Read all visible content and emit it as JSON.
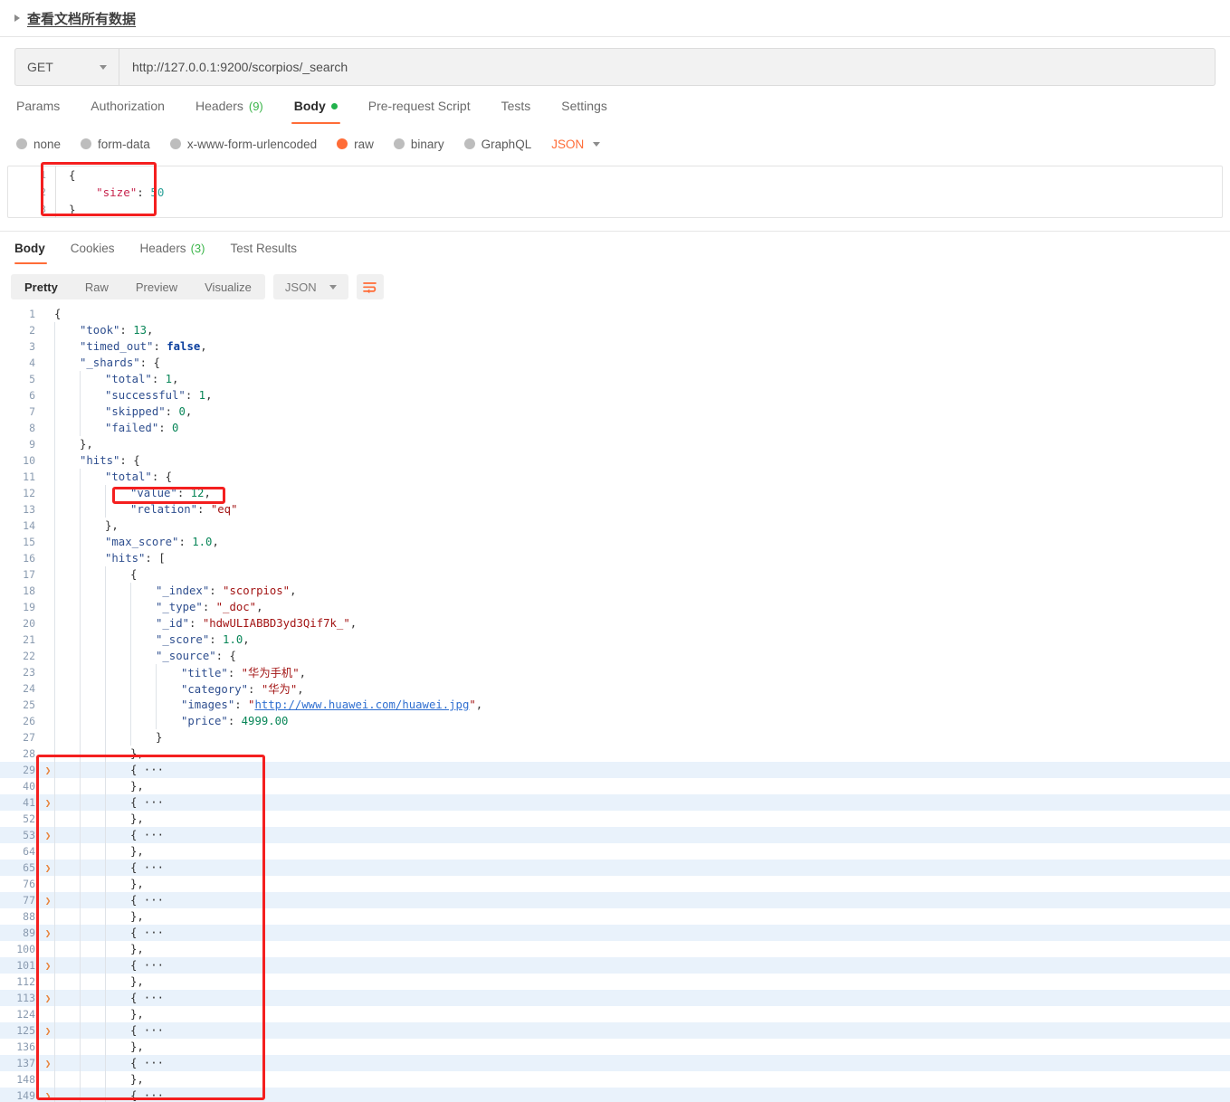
{
  "window": {
    "title": "查看文档所有数据",
    "collapse_icon": "triangle-right-icon"
  },
  "request": {
    "method": "GET",
    "url": "http://127.0.0.1:9200/scorpios/_search",
    "tabs": [
      {
        "label": "Params",
        "badge": "",
        "active": false
      },
      {
        "label": "Authorization",
        "badge": "",
        "active": false
      },
      {
        "label": "Headers",
        "badge": "(9)",
        "active": false
      },
      {
        "label": "Body",
        "badge": "",
        "active": true,
        "dot": true
      },
      {
        "label": "Pre-request Script",
        "badge": "",
        "active": false
      },
      {
        "label": "Tests",
        "badge": "",
        "active": false
      },
      {
        "label": "Settings",
        "badge": "",
        "active": false
      }
    ],
    "body_types": [
      {
        "label": "none",
        "selected": false
      },
      {
        "label": "form-data",
        "selected": false
      },
      {
        "label": "x-www-form-urlencoded",
        "selected": false
      },
      {
        "label": "raw",
        "selected": true
      },
      {
        "label": "binary",
        "selected": false
      },
      {
        "label": "GraphQL",
        "selected": false
      }
    ],
    "raw_format": "JSON",
    "editor_lines": [
      {
        "n": "1",
        "code": "{"
      },
      {
        "n": "2",
        "code": "    \"size\": 50"
      },
      {
        "n": "3",
        "code": "}"
      }
    ],
    "annotation": "red-highlight-box-request-size"
  },
  "response": {
    "tabs": [
      {
        "label": "Body",
        "badge": "",
        "active": true
      },
      {
        "label": "Cookies",
        "badge": "",
        "active": false
      },
      {
        "label": "Headers",
        "badge": "(3)",
        "active": false
      },
      {
        "label": "Test Results",
        "badge": "",
        "active": false
      }
    ],
    "view_modes": [
      {
        "label": "Pretty",
        "active": true
      },
      {
        "label": "Raw",
        "active": false
      },
      {
        "label": "Preview",
        "active": false
      },
      {
        "label": "Visualize",
        "active": false
      }
    ],
    "format": "JSON",
    "wrap_icon": "wrap-text-icon",
    "annotations": [
      "red-highlight-box-hits-total-value",
      "red-highlight-box-collapsed-hits"
    ],
    "json_lines": [
      {
        "n": "1",
        "indent": 0,
        "tokens": [
          {
            "t": "punc",
            "v": "{"
          }
        ]
      },
      {
        "n": "2",
        "indent": 1,
        "tokens": [
          {
            "t": "key",
            "v": "\"took\""
          },
          {
            "t": "punc",
            "v": ": "
          },
          {
            "t": "num",
            "v": "13"
          },
          {
            "t": "punc",
            "v": ","
          }
        ]
      },
      {
        "n": "3",
        "indent": 1,
        "tokens": [
          {
            "t": "key",
            "v": "\"timed_out\""
          },
          {
            "t": "punc",
            "v": ": "
          },
          {
            "t": "bool",
            "v": "false"
          },
          {
            "t": "punc",
            "v": ","
          }
        ]
      },
      {
        "n": "4",
        "indent": 1,
        "tokens": [
          {
            "t": "key",
            "v": "\"_shards\""
          },
          {
            "t": "punc",
            "v": ": {"
          }
        ]
      },
      {
        "n": "5",
        "indent": 2,
        "tokens": [
          {
            "t": "key",
            "v": "\"total\""
          },
          {
            "t": "punc",
            "v": ": "
          },
          {
            "t": "num",
            "v": "1"
          },
          {
            "t": "punc",
            "v": ","
          }
        ]
      },
      {
        "n": "6",
        "indent": 2,
        "tokens": [
          {
            "t": "key",
            "v": "\"successful\""
          },
          {
            "t": "punc",
            "v": ": "
          },
          {
            "t": "num",
            "v": "1"
          },
          {
            "t": "punc",
            "v": ","
          }
        ]
      },
      {
        "n": "7",
        "indent": 2,
        "tokens": [
          {
            "t": "key",
            "v": "\"skipped\""
          },
          {
            "t": "punc",
            "v": ": "
          },
          {
            "t": "num",
            "v": "0"
          },
          {
            "t": "punc",
            "v": ","
          }
        ]
      },
      {
        "n": "8",
        "indent": 2,
        "tokens": [
          {
            "t": "key",
            "v": "\"failed\""
          },
          {
            "t": "punc",
            "v": ": "
          },
          {
            "t": "num",
            "v": "0"
          }
        ]
      },
      {
        "n": "9",
        "indent": 1,
        "tokens": [
          {
            "t": "punc",
            "v": "},"
          }
        ]
      },
      {
        "n": "10",
        "indent": 1,
        "tokens": [
          {
            "t": "key",
            "v": "\"hits\""
          },
          {
            "t": "punc",
            "v": ": {"
          }
        ]
      },
      {
        "n": "11",
        "indent": 2,
        "tokens": [
          {
            "t": "key",
            "v": "\"total\""
          },
          {
            "t": "punc",
            "v": ": {"
          }
        ]
      },
      {
        "n": "12",
        "indent": 3,
        "tokens": [
          {
            "t": "key",
            "v": "\"value\""
          },
          {
            "t": "punc",
            "v": ": "
          },
          {
            "t": "num",
            "v": "12"
          },
          {
            "t": "punc",
            "v": ","
          }
        ]
      },
      {
        "n": "13",
        "indent": 3,
        "tokens": [
          {
            "t": "key",
            "v": "\"relation\""
          },
          {
            "t": "punc",
            "v": ": "
          },
          {
            "t": "str",
            "v": "\"eq\""
          }
        ]
      },
      {
        "n": "14",
        "indent": 2,
        "tokens": [
          {
            "t": "punc",
            "v": "},"
          }
        ]
      },
      {
        "n": "15",
        "indent": 2,
        "tokens": [
          {
            "t": "key",
            "v": "\"max_score\""
          },
          {
            "t": "punc",
            "v": ": "
          },
          {
            "t": "num",
            "v": "1.0"
          },
          {
            "t": "punc",
            "v": ","
          }
        ]
      },
      {
        "n": "16",
        "indent": 2,
        "tokens": [
          {
            "t": "key",
            "v": "\"hits\""
          },
          {
            "t": "punc",
            "v": ": ["
          }
        ]
      },
      {
        "n": "17",
        "indent": 3,
        "tokens": [
          {
            "t": "punc",
            "v": "{"
          }
        ]
      },
      {
        "n": "18",
        "indent": 4,
        "tokens": [
          {
            "t": "key",
            "v": "\"_index\""
          },
          {
            "t": "punc",
            "v": ": "
          },
          {
            "t": "str",
            "v": "\"scorpios\""
          },
          {
            "t": "punc",
            "v": ","
          }
        ]
      },
      {
        "n": "19",
        "indent": 4,
        "tokens": [
          {
            "t": "key",
            "v": "\"_type\""
          },
          {
            "t": "punc",
            "v": ": "
          },
          {
            "t": "str",
            "v": "\"_doc\""
          },
          {
            "t": "punc",
            "v": ","
          }
        ]
      },
      {
        "n": "20",
        "indent": 4,
        "tokens": [
          {
            "t": "key",
            "v": "\"_id\""
          },
          {
            "t": "punc",
            "v": ": "
          },
          {
            "t": "str",
            "v": "\"hdwULIABBD3yd3Qif7k_\""
          },
          {
            "t": "punc",
            "v": ","
          }
        ]
      },
      {
        "n": "21",
        "indent": 4,
        "tokens": [
          {
            "t": "key",
            "v": "\"_score\""
          },
          {
            "t": "punc",
            "v": ": "
          },
          {
            "t": "num",
            "v": "1.0"
          },
          {
            "t": "punc",
            "v": ","
          }
        ]
      },
      {
        "n": "22",
        "indent": 4,
        "tokens": [
          {
            "t": "key",
            "v": "\"_source\""
          },
          {
            "t": "punc",
            "v": ": {"
          }
        ]
      },
      {
        "n": "23",
        "indent": 5,
        "tokens": [
          {
            "t": "key",
            "v": "\"title\""
          },
          {
            "t": "punc",
            "v": ": "
          },
          {
            "t": "str",
            "v": "\"华为手机\""
          },
          {
            "t": "punc",
            "v": ","
          }
        ]
      },
      {
        "n": "24",
        "indent": 5,
        "tokens": [
          {
            "t": "key",
            "v": "\"category\""
          },
          {
            "t": "punc",
            "v": ": "
          },
          {
            "t": "str",
            "v": "\"华为\""
          },
          {
            "t": "punc",
            "v": ","
          }
        ]
      },
      {
        "n": "25",
        "indent": 5,
        "tokens": [
          {
            "t": "key",
            "v": "\"images\""
          },
          {
            "t": "punc",
            "v": ": "
          },
          {
            "t": "str",
            "v": "\""
          },
          {
            "t": "link",
            "v": "http://www.huawei.com/huawei.jpg"
          },
          {
            "t": "str",
            "v": "\""
          },
          {
            "t": "punc",
            "v": ","
          }
        ]
      },
      {
        "n": "26",
        "indent": 5,
        "tokens": [
          {
            "t": "key",
            "v": "\"price\""
          },
          {
            "t": "punc",
            "v": ": "
          },
          {
            "t": "num",
            "v": "4999.00"
          }
        ]
      },
      {
        "n": "27",
        "indent": 4,
        "tokens": [
          {
            "t": "punc",
            "v": "}"
          }
        ]
      },
      {
        "n": "28",
        "indent": 3,
        "tokens": [
          {
            "t": "punc",
            "v": "},"
          }
        ]
      },
      {
        "n": "29",
        "indent": 3,
        "fold": true,
        "chevron": true,
        "tokens": [
          {
            "t": "punc",
            "v": "{ ···"
          }
        ]
      },
      {
        "n": "40",
        "indent": 3,
        "tokens": [
          {
            "t": "punc",
            "v": "},"
          }
        ]
      },
      {
        "n": "41",
        "indent": 3,
        "fold": true,
        "chevron": true,
        "tokens": [
          {
            "t": "punc",
            "v": "{ ···"
          }
        ]
      },
      {
        "n": "52",
        "indent": 3,
        "tokens": [
          {
            "t": "punc",
            "v": "},"
          }
        ]
      },
      {
        "n": "53",
        "indent": 3,
        "fold": true,
        "chevron": true,
        "tokens": [
          {
            "t": "punc",
            "v": "{ ···"
          }
        ]
      },
      {
        "n": "64",
        "indent": 3,
        "tokens": [
          {
            "t": "punc",
            "v": "},"
          }
        ]
      },
      {
        "n": "65",
        "indent": 3,
        "fold": true,
        "chevron": true,
        "tokens": [
          {
            "t": "punc",
            "v": "{ ···"
          }
        ]
      },
      {
        "n": "76",
        "indent": 3,
        "tokens": [
          {
            "t": "punc",
            "v": "},"
          }
        ]
      },
      {
        "n": "77",
        "indent": 3,
        "fold": true,
        "chevron": true,
        "tokens": [
          {
            "t": "punc",
            "v": "{ ···"
          }
        ]
      },
      {
        "n": "88",
        "indent": 3,
        "tokens": [
          {
            "t": "punc",
            "v": "},"
          }
        ]
      },
      {
        "n": "89",
        "indent": 3,
        "fold": true,
        "chevron": true,
        "tokens": [
          {
            "t": "punc",
            "v": "{ ···"
          }
        ]
      },
      {
        "n": "100",
        "indent": 3,
        "tokens": [
          {
            "t": "punc",
            "v": "},"
          }
        ]
      },
      {
        "n": "101",
        "indent": 3,
        "fold": true,
        "chevron": true,
        "tokens": [
          {
            "t": "punc",
            "v": "{ ···"
          }
        ]
      },
      {
        "n": "112",
        "indent": 3,
        "tokens": [
          {
            "t": "punc",
            "v": "},"
          }
        ]
      },
      {
        "n": "113",
        "indent": 3,
        "fold": true,
        "chevron": true,
        "tokens": [
          {
            "t": "punc",
            "v": "{ ···"
          }
        ]
      },
      {
        "n": "124",
        "indent": 3,
        "tokens": [
          {
            "t": "punc",
            "v": "},"
          }
        ]
      },
      {
        "n": "125",
        "indent": 3,
        "fold": true,
        "chevron": true,
        "tokens": [
          {
            "t": "punc",
            "v": "{ ···"
          }
        ]
      },
      {
        "n": "136",
        "indent": 3,
        "tokens": [
          {
            "t": "punc",
            "v": "},"
          }
        ]
      },
      {
        "n": "137",
        "indent": 3,
        "fold": true,
        "chevron": true,
        "tokens": [
          {
            "t": "punc",
            "v": "{ ···"
          }
        ]
      },
      {
        "n": "148",
        "indent": 3,
        "tokens": [
          {
            "t": "punc",
            "v": "},"
          }
        ]
      },
      {
        "n": "149",
        "indent": 3,
        "fold": true,
        "chevron": true,
        "tokens": [
          {
            "t": "punc",
            "v": "{ ···"
          }
        ]
      }
    ]
  },
  "colors": {
    "accent": "#ff6c37",
    "annotation": "#f41f1f",
    "json_key": "#2f4f8f",
    "json_string": "#a31515",
    "json_number": "#098658",
    "json_bool": "#0b3f9e",
    "fold_row_bg": "#e9f2fb",
    "badge_green": "#3bb54a"
  }
}
